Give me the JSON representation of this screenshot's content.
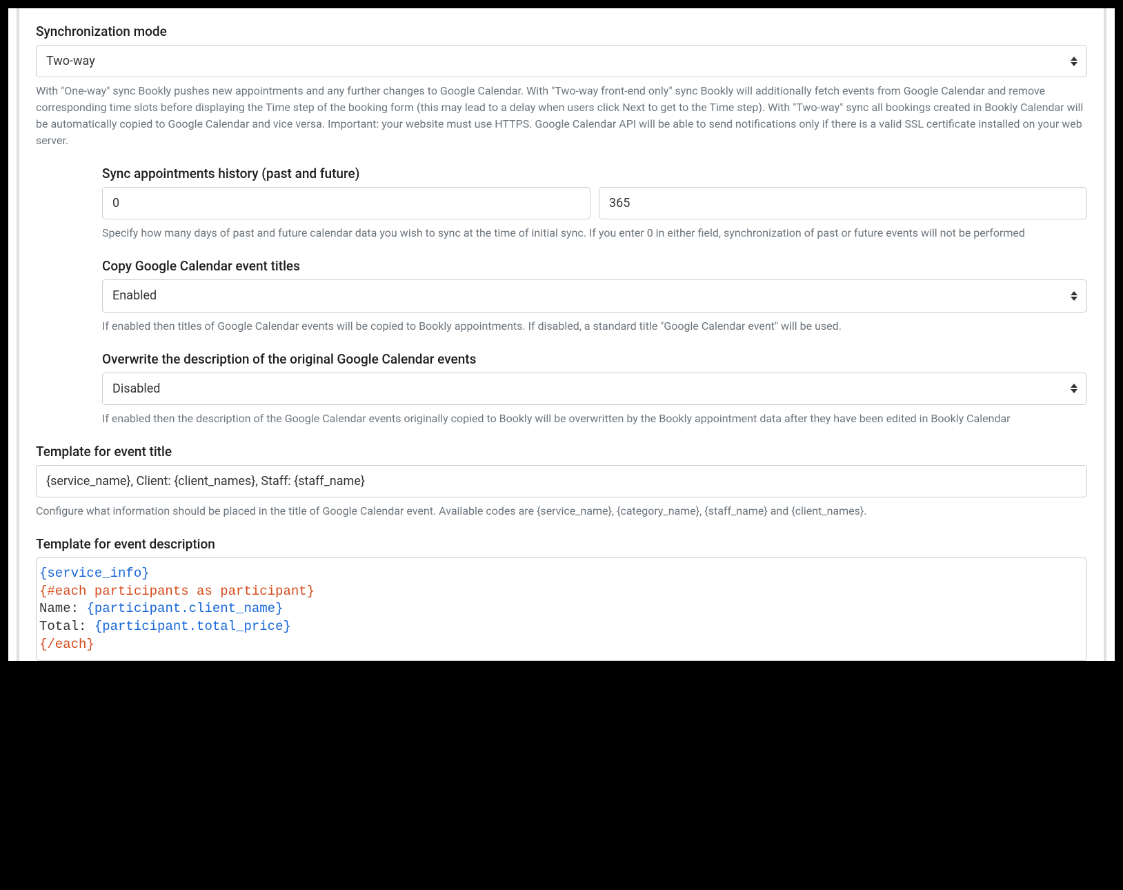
{
  "sync_mode": {
    "label": "Synchronization mode",
    "value": "Two-way",
    "help": "With \"One-way\" sync Bookly pushes new appointments and any further changes to Google Calendar. With \"Two-way front-end only\" sync Bookly will additionally fetch events from Google Calendar and remove corresponding time slots before displaying the Time step of the booking form (this may lead to a delay when users click Next to get to the Time step). With \"Two-way\" sync all bookings created in Bookly Calendar will be automatically copied to Google Calendar and vice versa. Important: your website must use HTTPS. Google Calendar API will be able to send notifications only if there is a valid SSL certificate installed on your web server."
  },
  "history": {
    "label": "Sync appointments history (past and future)",
    "past": "0",
    "future": "365",
    "help": "Specify how many days of past and future calendar data you wish to sync at the time of initial sync. If you enter 0 in either field, synchronization of past or future events will not be performed"
  },
  "copy_titles": {
    "label": "Copy Google Calendar event titles",
    "value": "Enabled",
    "help": "If enabled then titles of Google Calendar events will be copied to Bookly appointments. If disabled, a standard title \"Google Calendar event\" will be used."
  },
  "overwrite_desc": {
    "label": "Overwrite the description of the original Google Calendar events",
    "value": "Disabled",
    "help": "If enabled then the description of the Google Calendar events originally copied to Bookly will be overwritten by the Bookly appointment data after they have been edited in Bookly Calendar"
  },
  "template_title": {
    "label": "Template for event title",
    "value": "{service_name}, Client: {client_names}, Staff: {staff_name}",
    "help": "Configure what information should be placed in the title of Google Calendar event. Available codes are {service_name}, {category_name}, {staff_name} and {client_names}."
  },
  "template_desc": {
    "label": "Template for event description",
    "line1": "{service_info}",
    "line2": "{#each participants as participant}",
    "line3_a": "Name: ",
    "line3_b": "{participant.client_name}",
    "line4_a": "Total: ",
    "line4_b": "{participant.total_price}",
    "line5": "{/each}"
  }
}
